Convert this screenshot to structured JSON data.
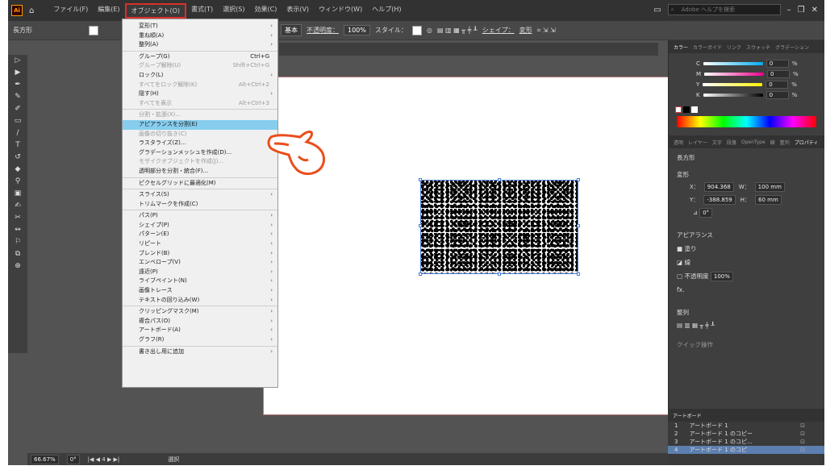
{
  "app": {
    "logo": "Ai",
    "home_icon": "home-icon"
  },
  "menubar": {
    "items": [
      "ファイル(F)",
      "編集(E)",
      "オブジェクト(O)",
      "書式(T)",
      "選択(S)",
      "効果(C)",
      "表示(V)",
      "ウィンドウ(W)",
      "ヘルプ(H)"
    ],
    "active": "オブジェクト(O)",
    "help_placeholder": "Adobe ヘルプを検索"
  },
  "control": {
    "object_type": "長方形",
    "stroke_style": "基本",
    "opacity_label": "不透明度：",
    "opacity": "100%",
    "style_label": "スタイル：",
    "shape_label": "シェイプ：",
    "transform_label": "変形"
  },
  "dropdown": {
    "items": [
      {
        "label": "変形(T)",
        "arrow": true
      },
      {
        "label": "重ね順(A)",
        "arrow": true
      },
      {
        "label": "整列(A)",
        "arrow": true
      },
      {
        "sep": true
      },
      {
        "label": "グループ(G)",
        "shortcut": "Ctrl+G"
      },
      {
        "label": "グループ解除(U)",
        "shortcut": "Shift+Ctrl+G",
        "disabled": true
      },
      {
        "label": "ロック(L)",
        "arrow": true
      },
      {
        "label": "すべてをロック解除(K)",
        "shortcut": "Alt+Ctrl+2",
        "disabled": true
      },
      {
        "label": "隠す(H)",
        "arrow": true
      },
      {
        "label": "すべてを表示",
        "shortcut": "Alt+Ctrl+3",
        "disabled": true
      },
      {
        "sep": true
      },
      {
        "label": "分割・拡張(X)...",
        "disabled": true
      },
      {
        "label": "アピアランスを分割(E)",
        "highlight": true
      },
      {
        "label": "画像の切り抜き(C)",
        "disabled": true
      },
      {
        "label": "ラスタライズ(Z)..."
      },
      {
        "label": "グラデーションメッシュを作成(D)..."
      },
      {
        "label": "モザイクオブジェクトを作成(J)...",
        "disabled": true
      },
      {
        "label": "透明部分を分割・統合(F)..."
      },
      {
        "sep": true
      },
      {
        "label": "ピクセルグリッドに最適化(M)"
      },
      {
        "sep": true
      },
      {
        "label": "スライス(S)",
        "arrow": true
      },
      {
        "label": "トリムマークを作成(C)"
      },
      {
        "sep": true
      },
      {
        "label": "パス(P)",
        "arrow": true
      },
      {
        "label": "シェイプ(P)",
        "arrow": true
      },
      {
        "label": "パターン(E)",
        "arrow": true
      },
      {
        "label": "リピート",
        "arrow": true
      },
      {
        "label": "ブレンド(B)",
        "arrow": true
      },
      {
        "label": "エンベロープ(V)",
        "arrow": true
      },
      {
        "label": "遠近(P)",
        "arrow": true
      },
      {
        "label": "ライブペイント(N)",
        "arrow": true
      },
      {
        "label": "画像トレース",
        "arrow": true
      },
      {
        "label": "テキストの回り込み(W)",
        "arrow": true
      },
      {
        "sep": true
      },
      {
        "label": "クリッピングマスク(M)",
        "arrow": true
      },
      {
        "label": "複合パス(O)",
        "arrow": true
      },
      {
        "label": "アートボード(A)",
        "arrow": true
      },
      {
        "label": "グラフ(R)",
        "arrow": true
      },
      {
        "sep": true
      },
      {
        "label": "書き出し用に追加",
        "arrow": true
      }
    ]
  },
  "color_panel": {
    "tabs": [
      "カラー",
      "カラーガイド",
      "リンク",
      "スウォッチ",
      "グラデーション"
    ],
    "channels": [
      {
        "name": "C",
        "value": "0",
        "unit": "%"
      },
      {
        "name": "M",
        "value": "0",
        "unit": "%"
      },
      {
        "name": "Y",
        "value": "0",
        "unit": "%"
      },
      {
        "name": "K",
        "value": "0",
        "unit": "%"
      }
    ]
  },
  "properties": {
    "tabs": [
      "透明",
      "レイヤー",
      "文字",
      "段落",
      "OpenType",
      "線",
      "整列",
      "プロパティ"
    ],
    "type": "長方形",
    "transform_title": "変形",
    "x_label": "X：",
    "x": "904.368",
    "y_label": "Y：",
    "y": "-388.859",
    "w_label": "W：",
    "w": "100 mm",
    "h_label": "H：",
    "h": "60 mm",
    "angle": "0°",
    "appearance_title": "アピアランス",
    "fill_label": "塗り",
    "stroke_label": "線",
    "opacity_label": "不透明度",
    "opacity": "100%",
    "fx": "fx.",
    "align_title": "整列",
    "quick_actions": "クイック操作"
  },
  "artboards": {
    "title": "アートボード",
    "rows": [
      {
        "n": "1",
        "name": "アートボード 1"
      },
      {
        "n": "2",
        "name": "アートボード 1 のコピー"
      },
      {
        "n": "3",
        "name": "アートボード 1 のコピ..."
      },
      {
        "n": "4",
        "name": "アートボード 1 のコピ"
      }
    ]
  },
  "status": {
    "zoom": "66.67%",
    "rotation": "0°",
    "artboard": "4",
    "tool": "選択"
  }
}
